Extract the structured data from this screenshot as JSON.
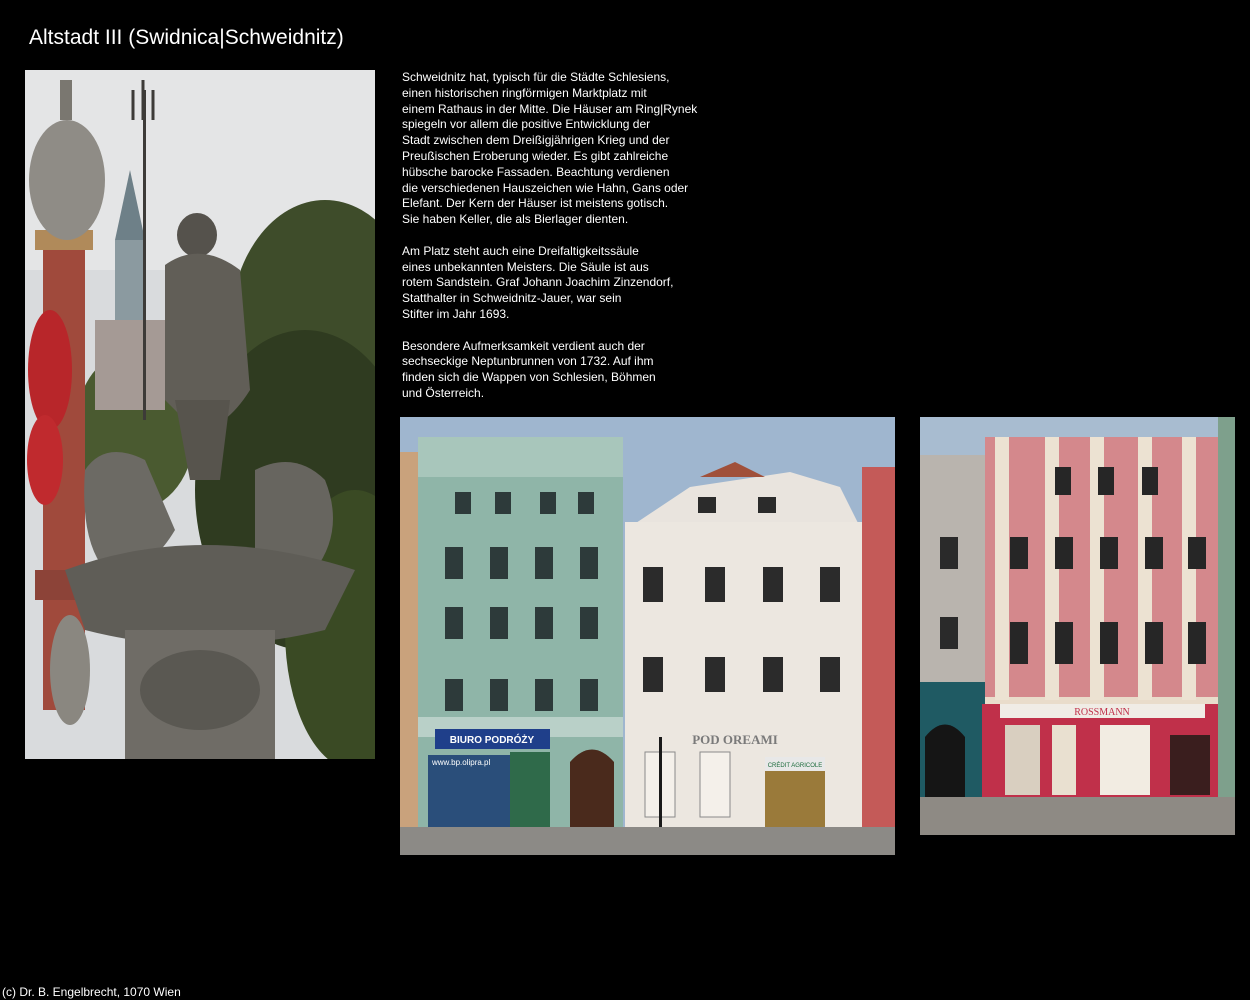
{
  "page": {
    "title": "Altstadt III (Swidnica|Schweidnitz)",
    "credit": "(c) Dr. B. Engelbrecht, 1070 Wien"
  },
  "description": {
    "paragraphs": [
      [
        "Schweidnitz hat, typisch für die Städte Schlesiens,",
        "einen historischen ringförmigen Marktplatz mit",
        "einem Rathaus in der Mitte. Die Häuser am Ring|Rynek",
        "spiegeln vor allem die positive Entwicklung der",
        "Stadt zwischen dem Dreißigjährigen Krieg und der",
        "Preußischen Eroberung wieder. Es gibt zahlreiche",
        "hübsche barocke Fassaden. Beachtung verdienen",
        "die verschiedenen Hauszeichen wie Hahn, Gans oder",
        "Elefant. Der Kern der Häuser ist meistens gotisch.",
        "Sie haben Keller, die als Bierlager dienten."
      ],
      [
        "Am Platz steht auch eine Dreifaltigkeitssäule",
        "eines unbekannten Meisters. Die Säule ist aus",
        "rotem Sandstein. Graf Johann Joachim Zinzendorf,",
        "Statthalter in Schweidnitz-Jauer, war sein",
        "Stifter im Jahr 1693."
      ],
      [
        "Besondere Aufmerksamkeit verdient auch der",
        "sechseckige Neptunbrunnen von 1732. Auf ihm",
        "finden sich die Wappen von Schlesien, Böhmen",
        "und Österreich."
      ]
    ]
  },
  "photos": {
    "houses_a": {
      "sign_left": "BIURO PODRÓŻY",
      "sign_web": "www.bp.olipra.pl",
      "sign_center": "POD OREAMI",
      "sign_bank": "CRÉDIT AGRICOLE"
    },
    "houses_b": {
      "sign_store": "ROSSMANN"
    }
  },
  "colors": {
    "background": "#000000",
    "text": "#ffffff"
  }
}
